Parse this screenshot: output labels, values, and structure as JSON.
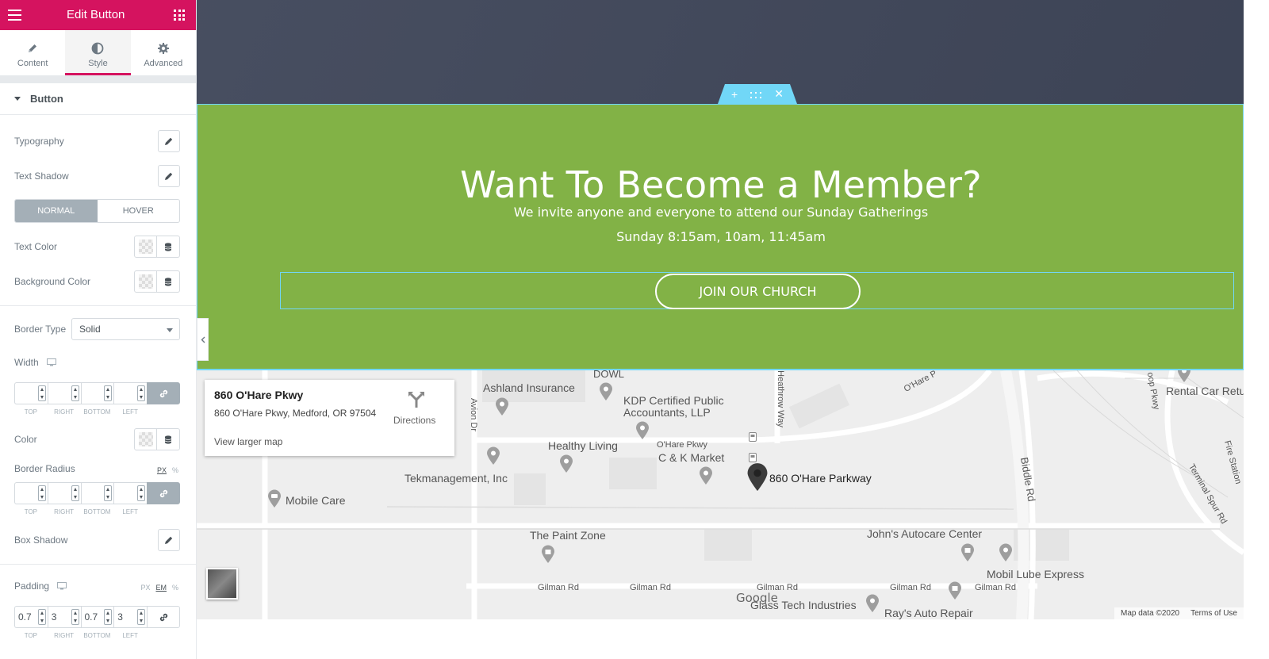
{
  "panel": {
    "title": "Edit Button",
    "tabs": [
      {
        "label": "Content",
        "icon": "pencil-icon"
      },
      {
        "label": "Style",
        "icon": "half-circle-icon"
      },
      {
        "label": "Advanced",
        "icon": "gear-icon"
      }
    ],
    "active_tab": "Style",
    "section": "Button",
    "typography_label": "Typography",
    "text_shadow_label": "Text Shadow",
    "state_tabs": {
      "normal": "NORMAL",
      "hover": "HOVER"
    },
    "text_color_label": "Text Color",
    "background_color_label": "Background Color",
    "border_type_label": "Border Type",
    "border_type_value": "Solid",
    "width_label": "Width",
    "dim_labels": {
      "top": "TOP",
      "right": "RIGHT",
      "bottom": "BOTTOM",
      "left": "LEFT"
    },
    "color_label": "Color",
    "border_radius_label": "Border Radius",
    "border_radius_units": {
      "px": "PX",
      "pct": "%"
    },
    "box_shadow_label": "Box Shadow",
    "padding_label": "Padding",
    "padding_units": {
      "px": "PX",
      "em": "EM",
      "pct": "%"
    },
    "padding_values": {
      "top": "0.7",
      "right": "3",
      "bottom": "0.7",
      "left": "3"
    },
    "accent_color": "#d5135f"
  },
  "preview": {
    "title": "Want To Become a Member?",
    "subtitle": "We invite anyone and everyone to attend our Sunday Gatherings",
    "times": "Sunday 8:15am, 10am, 11:45am",
    "button_label": "JOIN OUR CHURCH",
    "section_color": "#82b246",
    "dark_color": "#40475a"
  },
  "map": {
    "info": {
      "name": "860 O'Hare Pkwy",
      "address": "860 O'Hare Pkwy, Medford, OR 97504",
      "directions": "Directions",
      "larger": "View larger map"
    },
    "places": [
      "Ashland Insurance",
      "KDP Certified Public",
      "Accountants, LLP",
      "Healthy Living",
      "C & K Market",
      "860 O'Hare Parkway",
      "Tekmanagement, Inc",
      "Mobile Care",
      "The Paint Zone",
      "John's Autocare Center",
      "Mobil Lube Express",
      "Glass Tech Industries",
      "Ray's Auto Repair",
      "Rental Car Retu",
      "DOWL"
    ],
    "streets": {
      "gilman": "Gilman Rd",
      "ohare": "O'Hare Pkwy",
      "ohare2": "O'Hare P",
      "biddle": "Biddle Rd",
      "heathrow": "Heathrow Way",
      "avion": "Avion Dr",
      "terminal": "Terminal Spur Rd",
      "fire": "Fire Station",
      "loop": "oop Pkwy"
    },
    "google": "Google",
    "map_data": "Map data ©2020",
    "terms": "Terms of Use"
  }
}
